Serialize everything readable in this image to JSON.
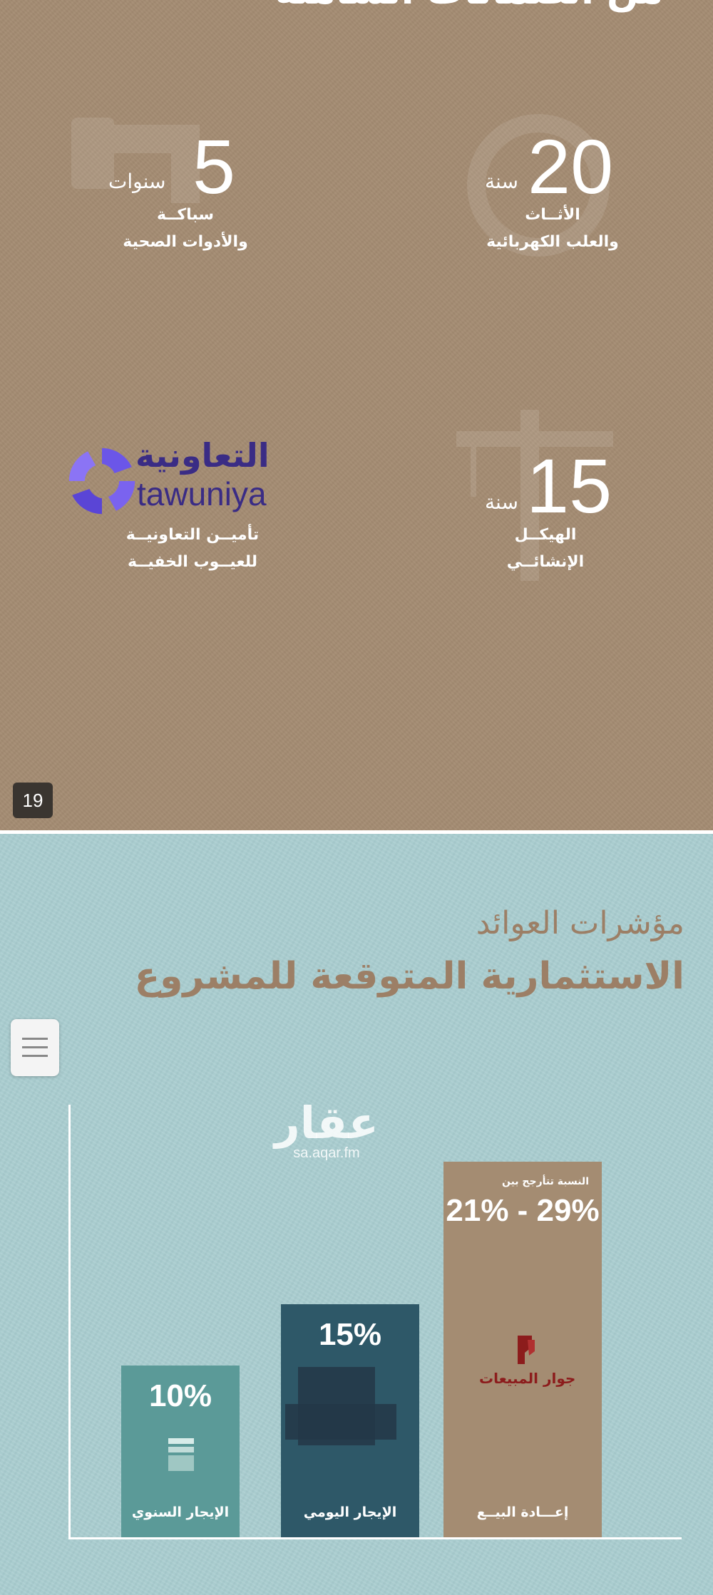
{
  "slide_top": {
    "cut_title": "من الضمانات الشاملة",
    "stats": [
      {
        "number": "20",
        "unit": "سنة",
        "desc_line1": "الأثــاث",
        "desc_line2": "والعلب الكهربائية",
        "watermark_icon": "lightbulb-icon"
      },
      {
        "number": "5",
        "unit": "سنوات",
        "desc_line1": "سباكــة",
        "desc_line2": "والأدوات الصحية",
        "watermark_icon": "pipe-icon"
      },
      {
        "number": "15",
        "unit": "سنة",
        "desc_line1": "الهيكــل",
        "desc_line2": "الإنشائــي",
        "watermark_icon": "crane-icon"
      }
    ],
    "tawuniya": {
      "name_ar": "التعاونية",
      "name_en": "tawuniya",
      "desc_line1": "تأميــن التعاونيــة",
      "desc_line2": "للعيــوب الخفيــة",
      "logo_color": "#6b56e8"
    },
    "page_number": "19",
    "background_color": "#a48c72"
  },
  "slide_bottom": {
    "title_line1": "مؤشرات العوائد",
    "title_line2": "الاستثمارية المتوقعة للمشروع",
    "watermark": {
      "ar": "عقار",
      "en": "sa.aqar.fm"
    },
    "menu_icon": "hamburger-menu-icon",
    "background_color": "#a9cdd0"
  },
  "chart_data": {
    "type": "bar",
    "categories": [
      "الإيجار السنوي",
      "الإيجار اليومي",
      "إعـــادة البيــع"
    ],
    "value_labels": [
      "10%",
      "15%",
      "21% - 29%"
    ],
    "values": [
      10,
      15,
      29
    ],
    "value_ranges": [
      [
        10,
        10
      ],
      [
        15,
        15
      ],
      [
        21,
        29
      ]
    ],
    "colors": [
      "#5b9a98",
      "#2e5868",
      "#a48c72"
    ],
    "bar_note": "النسبة تتأرجح بين",
    "brand_label": "جوار المبيعات",
    "title": "",
    "xlabel": "",
    "ylabel": ""
  }
}
